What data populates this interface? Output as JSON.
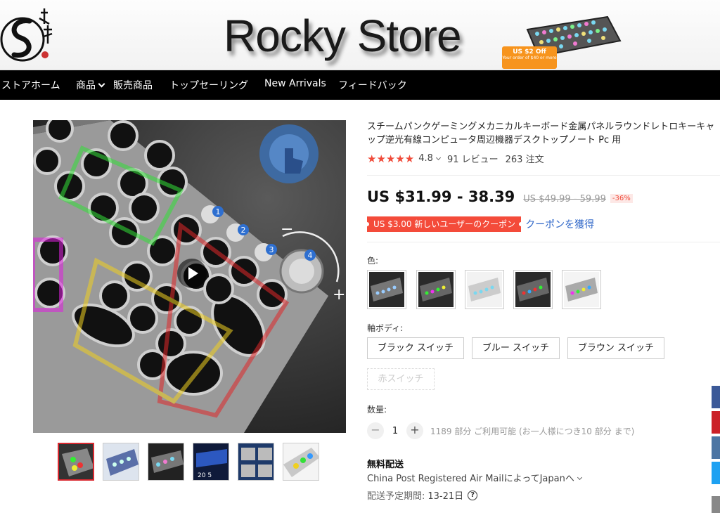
{
  "banner": {
    "store_name": "Rocky Store",
    "coupon_line1": "US $2 Off",
    "coupon_line2": "Your order of $40 or more"
  },
  "nav": {
    "items": [
      {
        "label": "ストアホーム"
      },
      {
        "label": "商品"
      },
      {
        "label": "販売商品"
      },
      {
        "label": "トップセーリング"
      },
      {
        "label": "New Arrivals"
      },
      {
        "label": "フィードバック"
      }
    ]
  },
  "product": {
    "title": "スチームパンクゲーミングメカニカルキーボード金属パネルラウンドレトロキーキャップ逆光有線コンピュータ周辺機器デスクトップノート Pc 用",
    "stars": "★★★★★",
    "rating": "4.8",
    "reviews": "91 レビュー",
    "orders": "263 注文",
    "price": "US $31.99 - 38.39",
    "old_price": "US $49.99 - 59.99",
    "discount": "-36%",
    "coupon_tag": "US $3.00 新しいユーザーのクーポン",
    "coupon_link": "クーポンを獲得",
    "color_label": "色:",
    "switch_label": "軸ボディ:",
    "switches": [
      {
        "label": "ブラック スイッチ"
      },
      {
        "label": "ブルー スイッチ"
      },
      {
        "label": "ブラウン スイッチ"
      },
      {
        "label": "赤スイッチ"
      }
    ],
    "qty_label": "数量:",
    "qty_minus": "−",
    "qty_value": "1",
    "qty_plus": "+",
    "availability": "1189 部分 ご利用可能 (お一人様につき10 部分 まで)",
    "shipping_title": "無料配送",
    "shipping_method": "China Post Registered Air MailによってJapanへ",
    "delivery_label": "配送予定期間:",
    "delivery_value": "13-21日",
    "help_glyph": "?"
  },
  "colors": {
    "accent_red": "#f04b3a",
    "link_blue": "#2e66c8",
    "nav_bg": "#000000"
  }
}
